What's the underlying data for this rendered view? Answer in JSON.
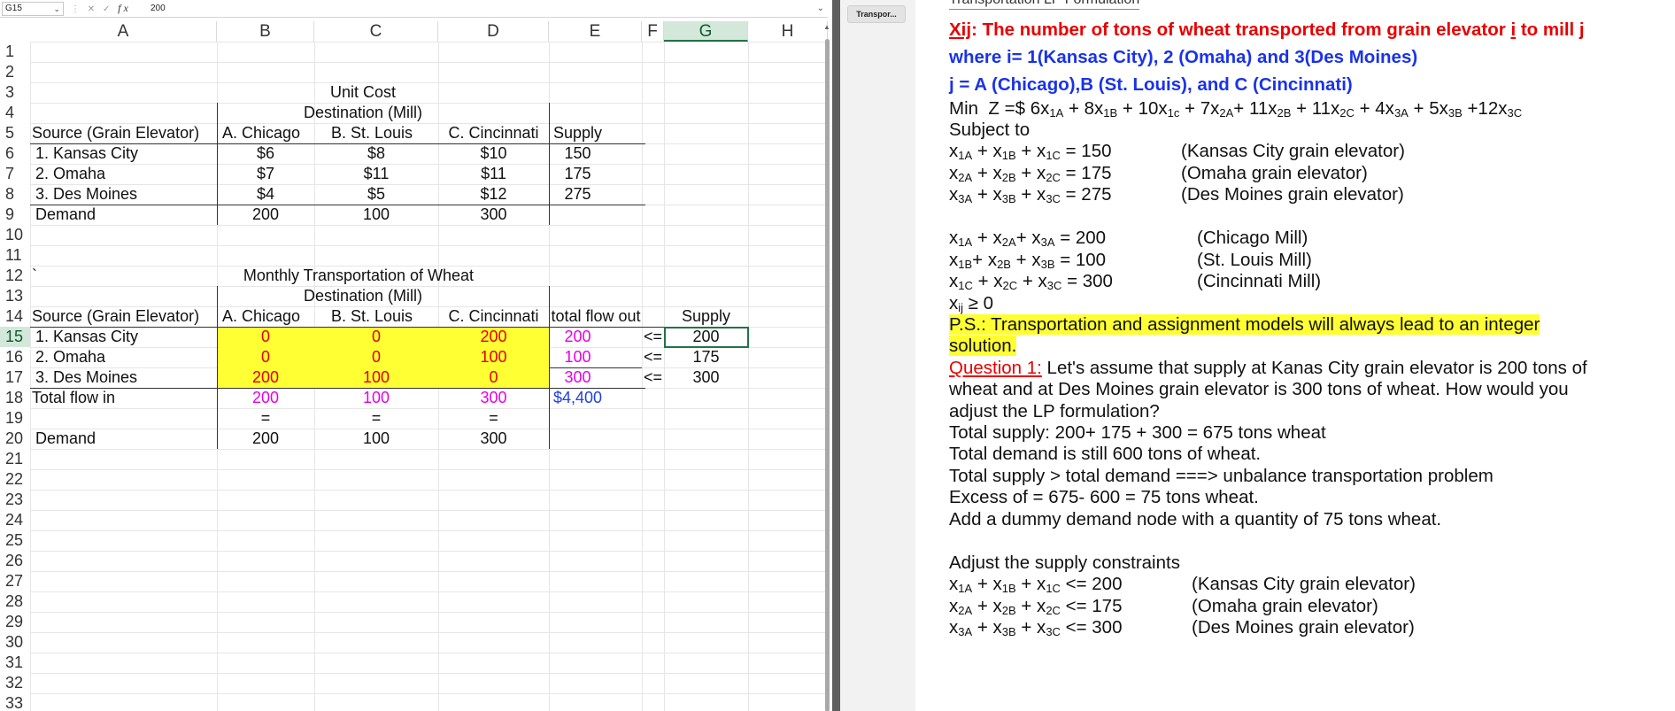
{
  "excel": {
    "name_box": "G15",
    "formula_value": "200",
    "columns": [
      "A",
      "B",
      "C",
      "D",
      "E",
      "F",
      "G",
      "H"
    ],
    "rows": [
      "1",
      "2",
      "3",
      "4",
      "5",
      "6",
      "7",
      "8",
      "9",
      "10",
      "11",
      "12",
      "13",
      "14",
      "15",
      "16",
      "17",
      "18",
      "19",
      "20",
      "21",
      "22",
      "23",
      "24",
      "25",
      "26",
      "27",
      "28",
      "29",
      "30",
      "31",
      "32",
      "33"
    ],
    "unit_cost": {
      "title": "Unit Cost",
      "subtitle": "Destination (Mill)",
      "headers": [
        "Source (Grain Elevator)",
        "A. Chicago",
        "B. St. Louis",
        "C. Cincinnati",
        "Supply"
      ],
      "rows": [
        [
          "1. Kansas City",
          "$6",
          "$8",
          "$10",
          "150"
        ],
        [
          "2. Omaha",
          "$7",
          "$11",
          "$11",
          "175"
        ],
        [
          "3. Des Moines",
          "$4",
          "$5",
          "$12",
          "275"
        ]
      ],
      "demand_label": "Demand",
      "demand": [
        "200",
        "100",
        "300"
      ]
    },
    "backtick": "`",
    "transport": {
      "title": "Monthly Transportation of Wheat",
      "subtitle": "Destination (Mill)",
      "headers": [
        "Source (Grain Elevator)",
        "A. Chicago",
        "B. St. Louis",
        "C. Cincinnati",
        "total flow out",
        "Supply"
      ],
      "rows": [
        {
          "label": "1. Kansas City",
          "vals": [
            "0",
            "0",
            "200"
          ],
          "out": "200",
          "op": "<=",
          "supply": "200"
        },
        {
          "label": "2. Omaha",
          "vals": [
            "0",
            "0",
            "100"
          ],
          "out": "100",
          "op": "<=",
          "supply": "175"
        },
        {
          "label": "3. Des Moines",
          "vals": [
            "200",
            "100",
            "0"
          ],
          "out": "300",
          "op": "<=",
          "supply": "300"
        }
      ],
      "total_label": "Total flow in",
      "totals": [
        "200",
        "100",
        "300"
      ],
      "total_cost": "$4,400",
      "eq": "=",
      "demand_label": "Demand",
      "demand": [
        "200",
        "100",
        "300"
      ]
    }
  },
  "thumbnail_label": "Transpor...",
  "slide": {
    "title": "Transportation LP Formulation",
    "line1_a": "Xij",
    "line1_b": ": The number of tons of wheat transported from grain elevator ",
    "line1_c": "i",
    "line1_d": " to mill j",
    "line2": "where i= 1(Kansas City), 2 (Omaha) and 3(Des Moines)",
    "line3": "j = A (Chicago),B (St. Louis), and C (Cincinnati)",
    "objective": "Min  Z =$ 6x1A + 8x1B + 10x1c + 7x2A+ 11x2B + 11x2C + 4x3A + 5x3B +12x3C",
    "subject_to": "Subject to",
    "supply_cons": [
      {
        "expr": "x1A + x1B + x1C = 150",
        "note": "(Kansas City grain elevator)"
      },
      {
        "expr": "x2A + x2B + x2C = 175",
        "note": "(Omaha grain elevator)"
      },
      {
        "expr": "x3A + x3B + x3C = 275",
        "note": "(Des Moines grain elevator)"
      }
    ],
    "demand_cons": [
      {
        "expr": "x1A + x2A+ x3A = 200",
        "note": "(Chicago Mill)"
      },
      {
        "expr": "x1B+ x2B + x3B = 100",
        "note": "(St. Louis Mill)"
      },
      {
        "expr": "x1C + x2C + x3C = 300",
        "note": "(Cincinnati Mill)"
      }
    ],
    "nonneg": "xij ≥ 0",
    "ps1": "P.S.: Transportation and assignment models will always lead to an integer",
    "ps2": "solution.",
    "q_label": "Question 1:",
    "q1": " Let's assume that supply at Kanas City grain elevator is 200 tons of",
    "q2": "wheat and at Des Moines grain elevator is 300 tons of wheat. How would you",
    "q3": "adjust the LP formulation?",
    "a1": "Total supply: 200+ 175 + 300 = 675 tons wheat",
    "a2": "Total demand is still 600 tons of wheat.",
    "a3": "Total supply > total demand ===> unbalance transportation problem",
    "a4": "Excess of = 675- 600 = 75 tons wheat.",
    "a5": "Add a dummy demand node with a quantity of 75 tons wheat.",
    "adjust": "Adjust the supply constraints",
    "adj_cons": [
      {
        "expr": "x1A + x1B + x1C <= 200",
        "note": "(Kansas City grain elevator)"
      },
      {
        "expr": "x2A + x2B + x2C <= 175",
        "note": "(Omaha grain elevator)"
      },
      {
        "expr": "x3A + x3B + x3C <= 300",
        "note": "(Des Moines grain elevator)"
      }
    ]
  }
}
